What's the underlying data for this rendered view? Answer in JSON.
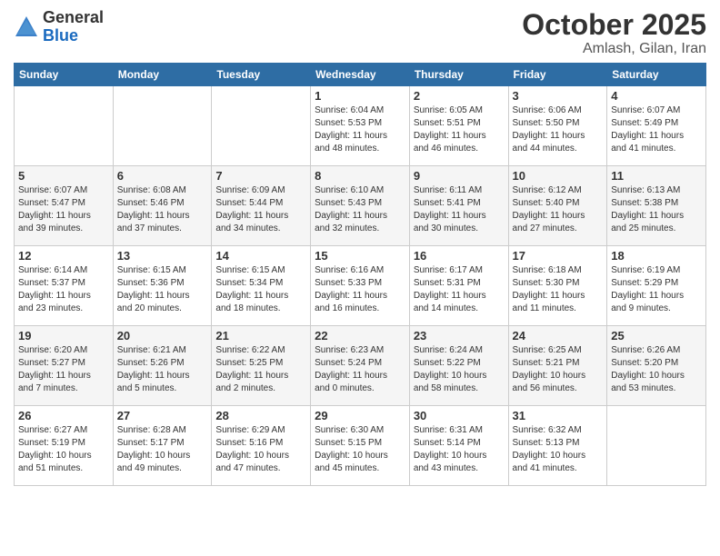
{
  "header": {
    "logo_general": "General",
    "logo_blue": "Blue",
    "month": "October 2025",
    "location": "Amlash, Gilan, Iran"
  },
  "weekdays": [
    "Sunday",
    "Monday",
    "Tuesday",
    "Wednesday",
    "Thursday",
    "Friday",
    "Saturday"
  ],
  "weeks": [
    [
      {
        "day": "",
        "info": ""
      },
      {
        "day": "",
        "info": ""
      },
      {
        "day": "",
        "info": ""
      },
      {
        "day": "1",
        "info": "Sunrise: 6:04 AM\nSunset: 5:53 PM\nDaylight: 11 hours\nand 48 minutes."
      },
      {
        "day": "2",
        "info": "Sunrise: 6:05 AM\nSunset: 5:51 PM\nDaylight: 11 hours\nand 46 minutes."
      },
      {
        "day": "3",
        "info": "Sunrise: 6:06 AM\nSunset: 5:50 PM\nDaylight: 11 hours\nand 44 minutes."
      },
      {
        "day": "4",
        "info": "Sunrise: 6:07 AM\nSunset: 5:49 PM\nDaylight: 11 hours\nand 41 minutes."
      }
    ],
    [
      {
        "day": "5",
        "info": "Sunrise: 6:07 AM\nSunset: 5:47 PM\nDaylight: 11 hours\nand 39 minutes."
      },
      {
        "day": "6",
        "info": "Sunrise: 6:08 AM\nSunset: 5:46 PM\nDaylight: 11 hours\nand 37 minutes."
      },
      {
        "day": "7",
        "info": "Sunrise: 6:09 AM\nSunset: 5:44 PM\nDaylight: 11 hours\nand 34 minutes."
      },
      {
        "day": "8",
        "info": "Sunrise: 6:10 AM\nSunset: 5:43 PM\nDaylight: 11 hours\nand 32 minutes."
      },
      {
        "day": "9",
        "info": "Sunrise: 6:11 AM\nSunset: 5:41 PM\nDaylight: 11 hours\nand 30 minutes."
      },
      {
        "day": "10",
        "info": "Sunrise: 6:12 AM\nSunset: 5:40 PM\nDaylight: 11 hours\nand 27 minutes."
      },
      {
        "day": "11",
        "info": "Sunrise: 6:13 AM\nSunset: 5:38 PM\nDaylight: 11 hours\nand 25 minutes."
      }
    ],
    [
      {
        "day": "12",
        "info": "Sunrise: 6:14 AM\nSunset: 5:37 PM\nDaylight: 11 hours\nand 23 minutes."
      },
      {
        "day": "13",
        "info": "Sunrise: 6:15 AM\nSunset: 5:36 PM\nDaylight: 11 hours\nand 20 minutes."
      },
      {
        "day": "14",
        "info": "Sunrise: 6:15 AM\nSunset: 5:34 PM\nDaylight: 11 hours\nand 18 minutes."
      },
      {
        "day": "15",
        "info": "Sunrise: 6:16 AM\nSunset: 5:33 PM\nDaylight: 11 hours\nand 16 minutes."
      },
      {
        "day": "16",
        "info": "Sunrise: 6:17 AM\nSunset: 5:31 PM\nDaylight: 11 hours\nand 14 minutes."
      },
      {
        "day": "17",
        "info": "Sunrise: 6:18 AM\nSunset: 5:30 PM\nDaylight: 11 hours\nand 11 minutes."
      },
      {
        "day": "18",
        "info": "Sunrise: 6:19 AM\nSunset: 5:29 PM\nDaylight: 11 hours\nand 9 minutes."
      }
    ],
    [
      {
        "day": "19",
        "info": "Sunrise: 6:20 AM\nSunset: 5:27 PM\nDaylight: 11 hours\nand 7 minutes."
      },
      {
        "day": "20",
        "info": "Sunrise: 6:21 AM\nSunset: 5:26 PM\nDaylight: 11 hours\nand 5 minutes."
      },
      {
        "day": "21",
        "info": "Sunrise: 6:22 AM\nSunset: 5:25 PM\nDaylight: 11 hours\nand 2 minutes."
      },
      {
        "day": "22",
        "info": "Sunrise: 6:23 AM\nSunset: 5:24 PM\nDaylight: 11 hours\nand 0 minutes."
      },
      {
        "day": "23",
        "info": "Sunrise: 6:24 AM\nSunset: 5:22 PM\nDaylight: 10 hours\nand 58 minutes."
      },
      {
        "day": "24",
        "info": "Sunrise: 6:25 AM\nSunset: 5:21 PM\nDaylight: 10 hours\nand 56 minutes."
      },
      {
        "day": "25",
        "info": "Sunrise: 6:26 AM\nSunset: 5:20 PM\nDaylight: 10 hours\nand 53 minutes."
      }
    ],
    [
      {
        "day": "26",
        "info": "Sunrise: 6:27 AM\nSunset: 5:19 PM\nDaylight: 10 hours\nand 51 minutes."
      },
      {
        "day": "27",
        "info": "Sunrise: 6:28 AM\nSunset: 5:17 PM\nDaylight: 10 hours\nand 49 minutes."
      },
      {
        "day": "28",
        "info": "Sunrise: 6:29 AM\nSunset: 5:16 PM\nDaylight: 10 hours\nand 47 minutes."
      },
      {
        "day": "29",
        "info": "Sunrise: 6:30 AM\nSunset: 5:15 PM\nDaylight: 10 hours\nand 45 minutes."
      },
      {
        "day": "30",
        "info": "Sunrise: 6:31 AM\nSunset: 5:14 PM\nDaylight: 10 hours\nand 43 minutes."
      },
      {
        "day": "31",
        "info": "Sunrise: 6:32 AM\nSunset: 5:13 PM\nDaylight: 10 hours\nand 41 minutes."
      },
      {
        "day": "",
        "info": ""
      }
    ]
  ]
}
